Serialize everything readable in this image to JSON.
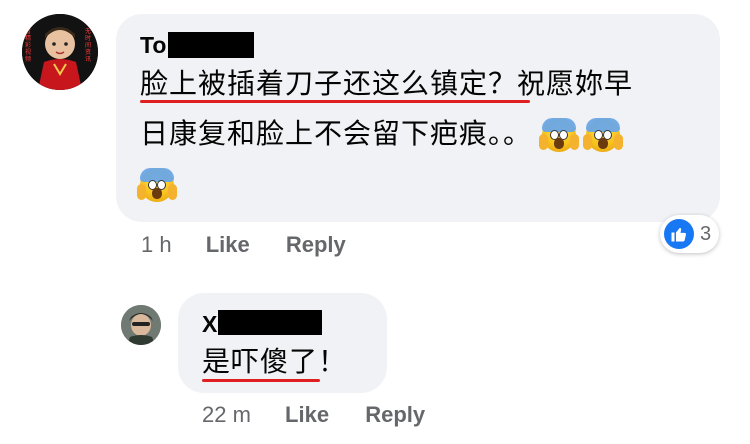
{
  "comment": {
    "author_visible": "To",
    "text_line1_underlined": "脸上被插着刀子还这么镇定",
    "text_line1_rest": "？祝愿妳早",
    "text_line2": "日康复和脸上不会留下疤痕。。",
    "avatar_banner_left": "看精彩视频",
    "avatar_banner_right": "无时间资讯",
    "time": "1 h",
    "like_label": "Like",
    "reply_label": "Reply",
    "reaction_count": "3"
  },
  "reply": {
    "author_visible": "X",
    "text_underlined": "是吓傻了",
    "text_rest": "！",
    "time": "22 m",
    "like_label": "Like",
    "reply_label": "Reply"
  },
  "colors": {
    "bubble_bg": "#f0f2f5",
    "underline": "#e02020",
    "meta_text": "#65676b",
    "like_blue": "#1877f2"
  }
}
